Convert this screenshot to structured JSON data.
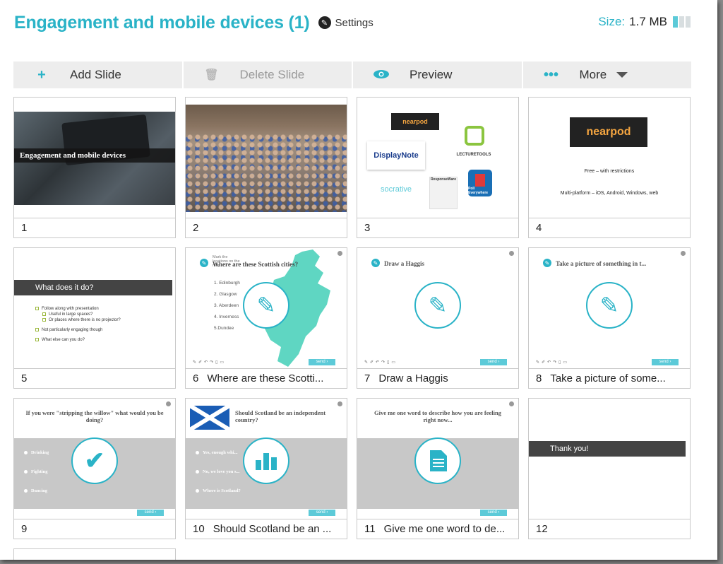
{
  "header": {
    "title": "Engagement and mobile devices (1)",
    "settings_label": "Settings",
    "size_label": "Size:",
    "size_value": "1.7 MB",
    "size_meter_filled": 1,
    "size_meter_total": 3
  },
  "colors": {
    "accent": "#2ab3c7",
    "toolbar_bg": "#ededed",
    "send_button": "#5ccad8"
  },
  "toolbar": {
    "add": {
      "icon": "plus-icon",
      "label": "Add Slide"
    },
    "delete": {
      "icon": "trash-icon",
      "label": "Delete Slide",
      "disabled": true
    },
    "preview": {
      "icon": "eye-icon",
      "label": "Preview"
    },
    "more": {
      "icon": "dots-icon",
      "label": "More"
    }
  },
  "slides": [
    {
      "number": "1",
      "caption": "",
      "content": {
        "title": "Engagement and mobile devices"
      }
    },
    {
      "number": "2",
      "caption": "",
      "content": {
        "description": "Photo of lecture hall audience with laptops"
      }
    },
    {
      "number": "3",
      "caption": "",
      "content": {
        "logos": [
          "nearpod",
          "DisplayNote",
          "LECTURETOOLS",
          "socrative",
          "ResponseWare",
          "Poll Everywhere"
        ]
      }
    },
    {
      "number": "4",
      "caption": "",
      "content": {
        "logo": "nearpod",
        "line1": "Free – with restrictions",
        "line2": "Multi-platform – iOS, Android, Windows, web"
      }
    },
    {
      "number": "5",
      "caption": "",
      "content": {
        "heading": "What does it do?",
        "bullets": [
          {
            "text": "Follow along with presentation",
            "level": 1
          },
          {
            "text": "Useful in large spaces?",
            "level": 2
          },
          {
            "text": "Or places where there is no projector?",
            "level": 2
          },
          {
            "text": "Not particularly engaging though",
            "level": 1
          },
          {
            "text": "What else can you do?",
            "level": 1
          }
        ]
      }
    },
    {
      "number": "6",
      "caption": "Where are these Scotti...",
      "content": {
        "title": "Where are these Scottish cities?",
        "instruction": "Mark the locations on the map",
        "cities": [
          "1. Edinburgh",
          "2. Glasgow",
          "3. Aberdeen",
          "4. Inverness",
          "5.Dundee"
        ],
        "send": "send"
      }
    },
    {
      "number": "7",
      "caption": "Draw a Haggis",
      "content": {
        "title": "Draw a Haggis",
        "send": "send"
      }
    },
    {
      "number": "8",
      "caption": "Take a picture of some...",
      "content": {
        "title": "Take a picture of something in t...",
        "send": "send"
      }
    },
    {
      "number": "9",
      "caption": "",
      "content": {
        "title": "If you were \"stripping the willow\" what would you be doing?",
        "options": [
          "Drinking",
          "Fighting",
          "Dancing"
        ],
        "send": "send"
      }
    },
    {
      "number": "10",
      "caption": "Should Scotland be an ...",
      "content": {
        "title": "Should Scotland be an independent country?",
        "options": [
          "Yes, enough whi...",
          "No, we love you s...",
          "Where is Scotland?"
        ],
        "send": "send"
      }
    },
    {
      "number": "11",
      "caption": "Give me one word to de...",
      "content": {
        "title": "Give me one word to describe how you are feeling right now...",
        "send": "send"
      }
    },
    {
      "number": "12",
      "caption": "",
      "content": {
        "heading": "Thank you!"
      }
    }
  ]
}
